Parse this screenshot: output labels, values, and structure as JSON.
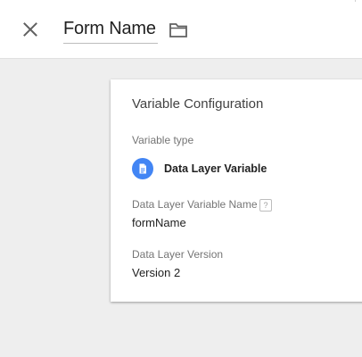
{
  "header": {
    "title": "Form Name",
    "close_icon": "close-icon",
    "folder_icon": "folder-icon"
  },
  "card": {
    "title": "Variable Configuration",
    "variable_type": {
      "label": "Variable type",
      "name": "Data Layer Variable",
      "icon": "document-icon",
      "icon_color": "#4285f4"
    },
    "variable_name": {
      "label": "Data Layer Variable Name",
      "help": "?",
      "value": "formName"
    },
    "version": {
      "label": "Data Layer Version",
      "value": "Version 2"
    }
  },
  "colors": {
    "background": "#eeeeee",
    "card": "#ffffff",
    "accent": "#4285f4"
  }
}
